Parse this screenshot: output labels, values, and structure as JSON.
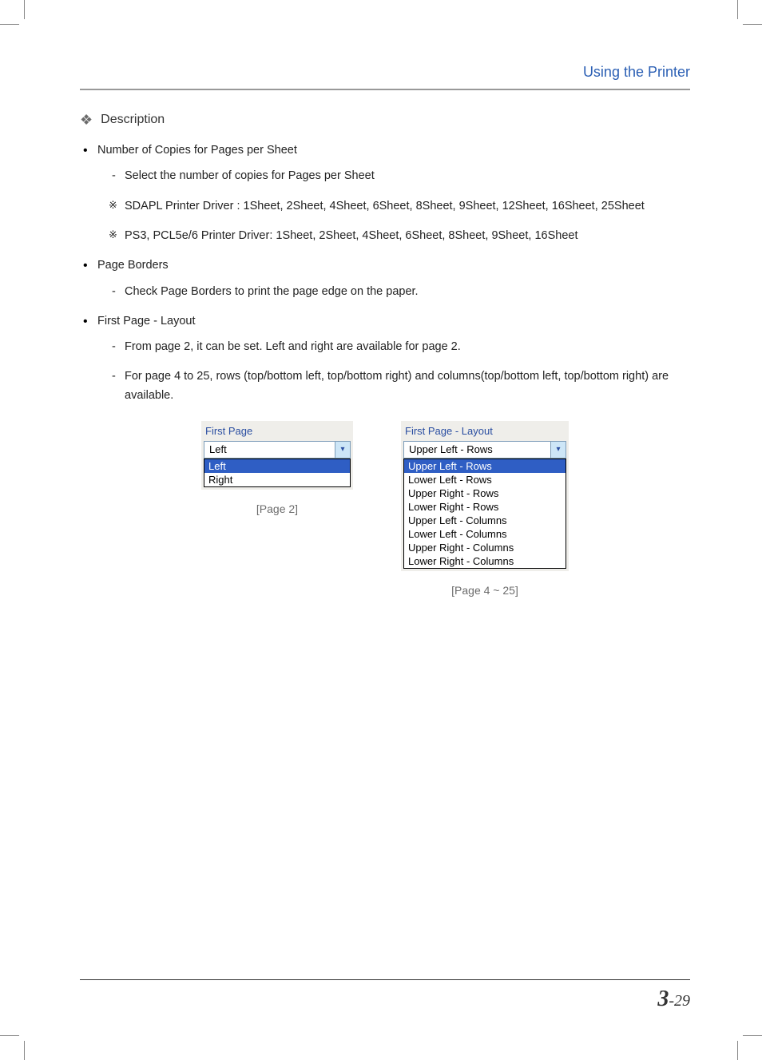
{
  "header": {
    "title": "Using the Printer"
  },
  "section": {
    "diamond": "❖",
    "title": "Description"
  },
  "items": [
    {
      "label": "Number of Copies for Pages per Sheet",
      "subs": [
        {
          "type": "dash",
          "text": "Select the number of copies for Pages per Sheet"
        },
        {
          "type": "ref",
          "text": "SDAPL Printer Driver : 1Sheet, 2Sheet, 4Sheet, 6Sheet, 8Sheet, 9Sheet, 12Sheet, 16Sheet, 25Sheet"
        },
        {
          "type": "ref",
          "text": "PS3, PCL5e/6 Printer Driver: 1Sheet, 2Sheet, 4Sheet, 6Sheet, 8Sheet, 9Sheet, 16Sheet"
        }
      ]
    },
    {
      "label": "Page Borders",
      "subs": [
        {
          "type": "dash",
          "text": "Check Page Borders to print the page edge on the paper."
        }
      ]
    },
    {
      "label": "First Page - Layout",
      "subs": [
        {
          "type": "dash",
          "text": "From page 2, it can be set. Left and right are available for page 2."
        },
        {
          "type": "dash",
          "text": "For page 4 to 25, rows (top/bottom left, top/bottom right) and columns(top/bottom left, top/bottom right) are available."
        }
      ]
    }
  ],
  "figA": {
    "label": "First Page",
    "value": "Left",
    "options": [
      "Left",
      "Right"
    ],
    "selected": "Left",
    "caption": "[Page 2]"
  },
  "figB": {
    "label": "First Page - Layout",
    "value": "Upper Left - Rows",
    "options": [
      "Upper Left - Rows",
      "Lower Left - Rows",
      "Upper Right - Rows",
      "Lower Right - Rows",
      "Upper Left - Columns",
      "Lower Left - Columns",
      "Upper Right - Columns",
      "Lower Right - Columns"
    ],
    "selected": "Upper Left - Rows",
    "caption": "[Page 4 ~ 25]"
  },
  "footer": {
    "chapter": "3",
    "sep": "-",
    "page": "29"
  }
}
